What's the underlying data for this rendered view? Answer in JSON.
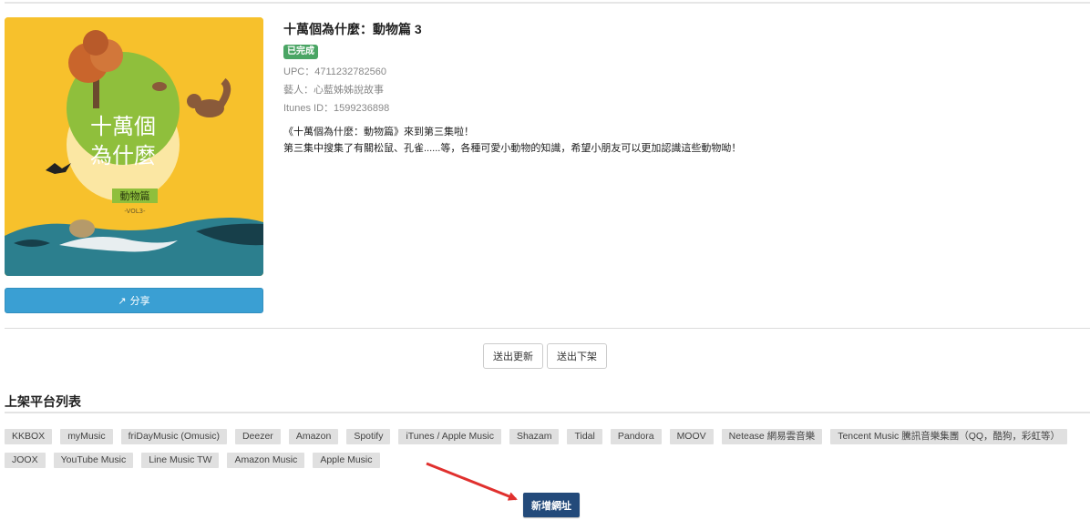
{
  "album": {
    "title": "十萬個為什麼：動物篇 3",
    "status": "已完成",
    "upc": "UPC：4711232782560",
    "artist": "藝人：心藍姊姊說故事",
    "itunes_id": "Itunes ID：1599236898",
    "description": [
      "《十萬個為什麼：動物篇》來到第三集啦！",
      "第三集中搜集了有關松鼠、孔雀......等，各種可愛小動物的知識，希望小朋友可以更加認識這些動物呦！"
    ],
    "cover": {
      "title_line1": "十萬個",
      "title_line2": "為什麼",
      "subtitle": "動物篇",
      "volume": "-VOL3-",
      "bg_color": "#f7c12c",
      "circle_color": "#8fbf3c"
    }
  },
  "share": {
    "icon": "share-icon",
    "label": "分享",
    "color": "#3a9fd3"
  },
  "actions": {
    "update_label": "送出更新",
    "takedown_label": "送出下架"
  },
  "platforms": {
    "title": "上架平台列表",
    "items": [
      "KKBOX",
      "myMusic",
      "friDayMusic (Omusic)",
      "Deezer",
      "Amazon",
      "Spotify",
      "iTunes / Apple Music",
      "Shazam",
      "Tidal",
      "Pandora",
      "MOOV",
      "Netease 網易雲音樂",
      "Tencent Music 騰訊音樂集團（QQ，酷狗，彩虹等）",
      "JOOX",
      "YouTube Music",
      "Line Music TW",
      "Amazon Music",
      "Apple Music"
    ]
  },
  "add_url": {
    "label": "新增網址",
    "color": "#234a7a"
  },
  "annotation": {
    "arrow_color": "#e0302e"
  }
}
